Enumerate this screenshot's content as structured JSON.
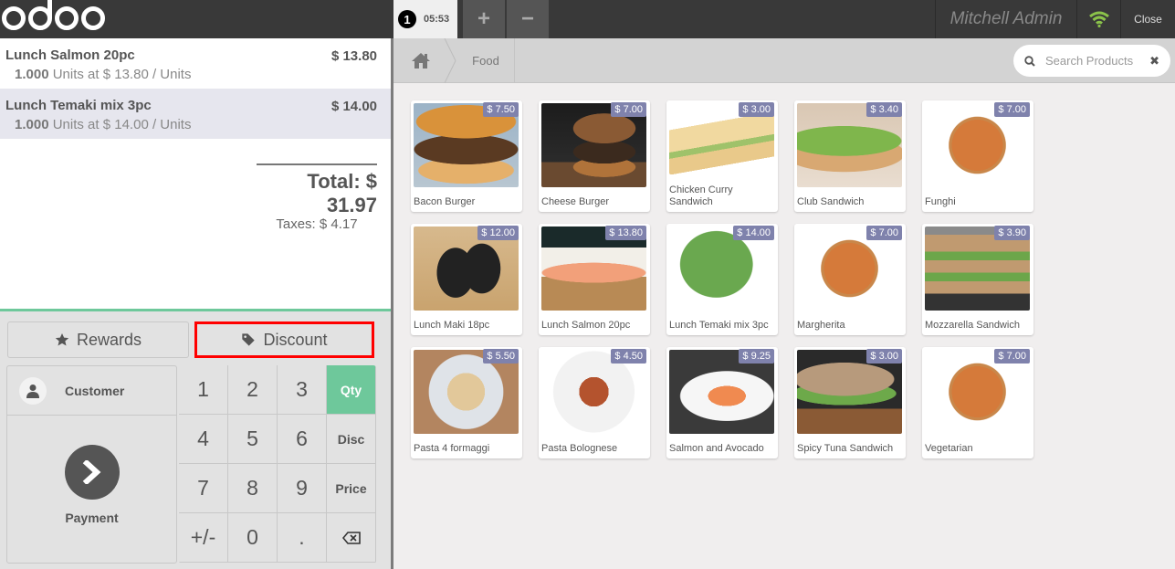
{
  "topbar": {
    "logo": "odoo",
    "order_tab": {
      "number": "1",
      "time": "05:53"
    },
    "add_order_label": "+",
    "remove_order_label": "−",
    "user_name": "Mitchell Admin",
    "connection_icon": "wifi-icon",
    "close_label": "Close"
  },
  "order": {
    "lines": [
      {
        "name": "Lunch Salmon 20pc",
        "price": "$ 13.80",
        "qty": "1.000",
        "info": "Units at $ 13.80 / Units",
        "selected": false
      },
      {
        "name": "Lunch Temaki mix 3pc",
        "price": "$ 14.00",
        "qty": "1.000",
        "info": "Units at $ 14.00 / Units",
        "selected": true
      }
    ],
    "total": "Total: $ 31.97",
    "taxes": "Taxes: $ 4.17"
  },
  "controls": {
    "rewards_label": "Rewards",
    "discount_label": "Discount",
    "highlight_color": "#ff0000"
  },
  "actionpad": {
    "customer_label": "Customer",
    "payment_label": "Payment"
  },
  "numpad": {
    "keys": [
      "1",
      "2",
      "3",
      "Qty",
      "4",
      "5",
      "6",
      "Disc",
      "7",
      "8",
      "9",
      "Price",
      "+/-",
      "0",
      ".",
      "⌫"
    ],
    "active_mode": "Qty",
    "accent_color": "#6ec89b"
  },
  "breadcrumbs": {
    "home_icon": "home-icon",
    "category": "Food"
  },
  "search": {
    "placeholder": "Search Products"
  },
  "products": [
    {
      "name": "Bacon Burger",
      "price": "$ 7.50"
    },
    {
      "name": "Cheese Burger",
      "price": "$ 7.00"
    },
    {
      "name": "Chicken Curry Sandwich",
      "price": "$ 3.00"
    },
    {
      "name": "Club Sandwich",
      "price": "$ 3.40"
    },
    {
      "name": "Funghi",
      "price": "$ 7.00"
    },
    {
      "name": "Lunch Maki 18pc",
      "price": "$ 12.00"
    },
    {
      "name": "Lunch Salmon 20pc",
      "price": "$ 13.80"
    },
    {
      "name": "Lunch Temaki mix 3pc",
      "price": "$ 14.00"
    },
    {
      "name": "Margherita",
      "price": "$ 7.00"
    },
    {
      "name": "Mozzarella Sandwich",
      "price": "$ 3.90"
    },
    {
      "name": "Pasta 4 formaggi",
      "price": "$ 5.50"
    },
    {
      "name": "Pasta Bolognese",
      "price": "$ 4.50"
    },
    {
      "name": "Salmon and Avocado",
      "price": "$ 9.25"
    },
    {
      "name": "Spicy Tuna Sandwich",
      "price": "$ 3.00"
    },
    {
      "name": "Vegetarian",
      "price": "$ 7.00"
    }
  ]
}
